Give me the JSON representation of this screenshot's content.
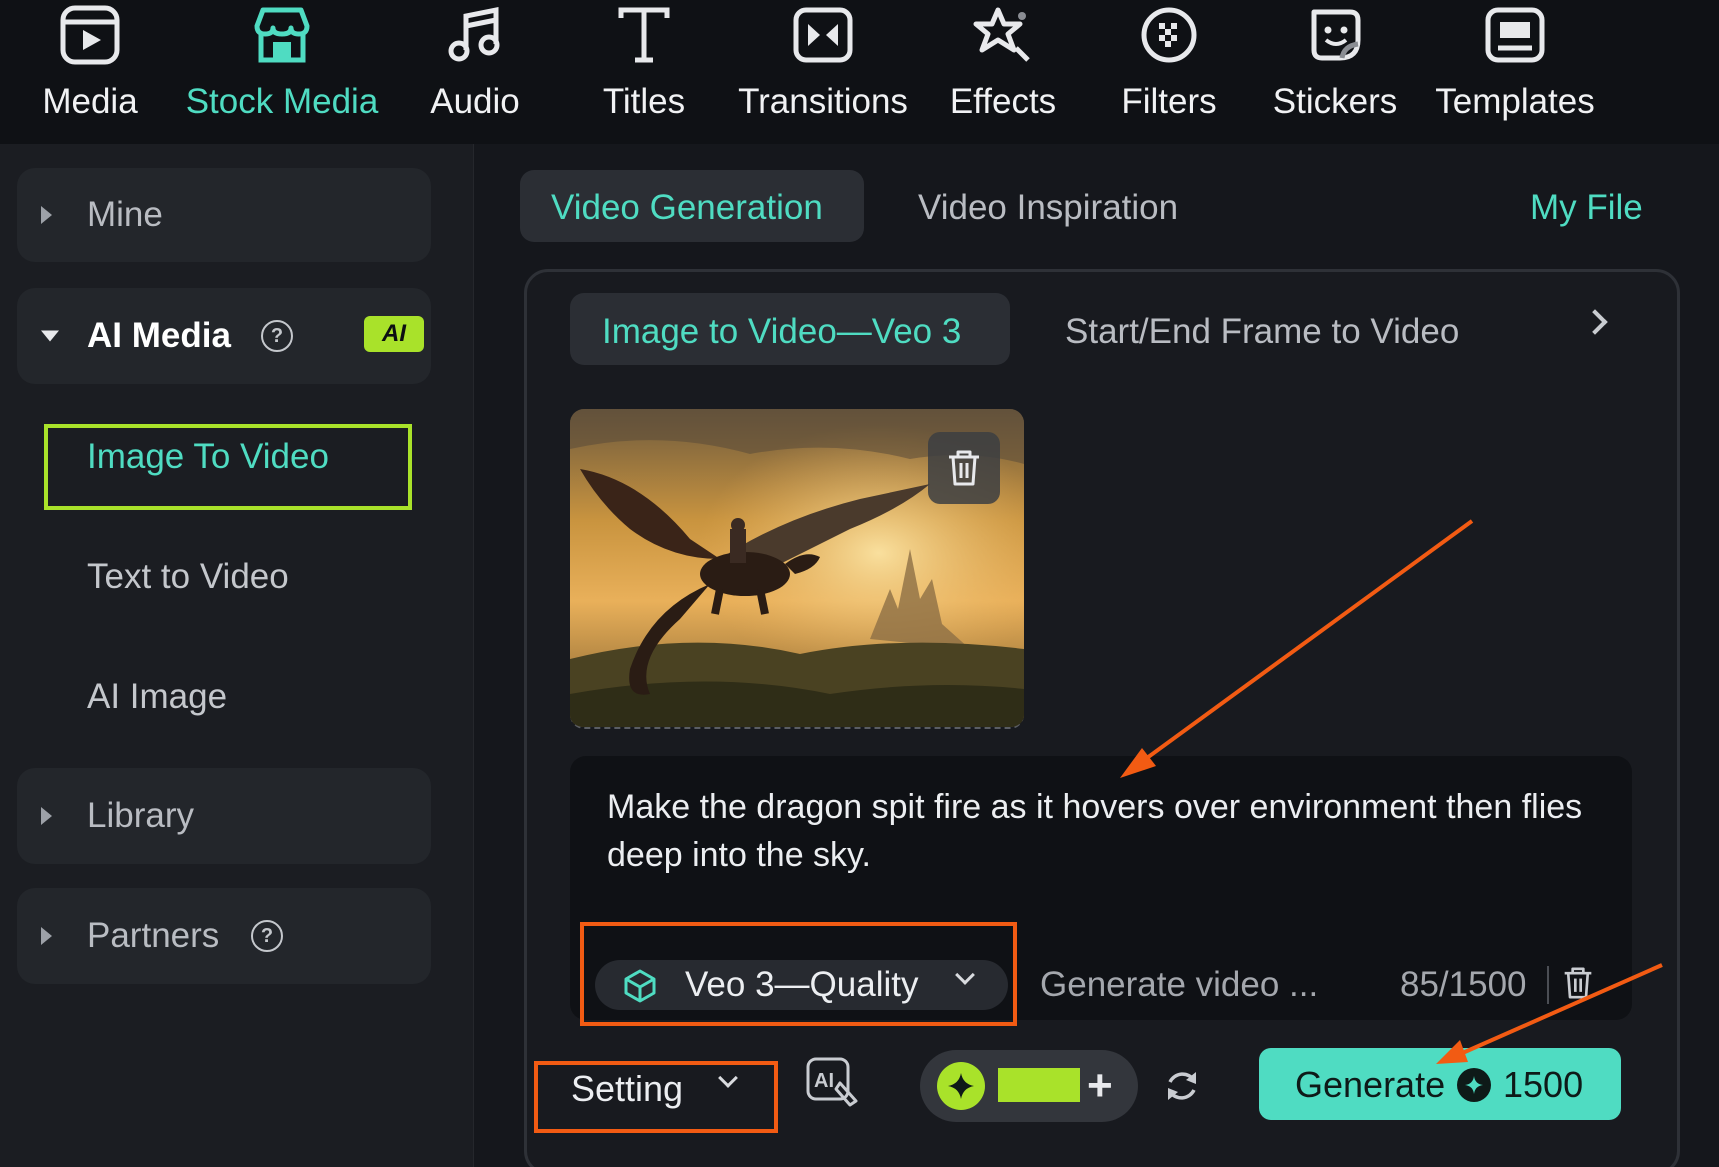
{
  "toolbar": {
    "items": [
      {
        "label": "Media",
        "icon": "media-icon"
      },
      {
        "label": "Stock Media",
        "icon": "stock-media-icon",
        "active": true
      },
      {
        "label": "Audio",
        "icon": "music-note-icon"
      },
      {
        "label": "Titles",
        "icon": "titles-icon"
      },
      {
        "label": "Transitions",
        "icon": "transitions-icon"
      },
      {
        "label": "Effects",
        "icon": "effects-icon"
      },
      {
        "label": "Filters",
        "icon": "filters-icon"
      },
      {
        "label": "Stickers",
        "icon": "stickers-icon"
      },
      {
        "label": "Templates",
        "icon": "templates-icon"
      }
    ]
  },
  "sidebar": {
    "mine": "Mine",
    "ai_media": "AI Media",
    "ai_badge": "AI",
    "sub_items": [
      "Image To Video",
      "Text to Video",
      "AI Image"
    ],
    "library": "Library",
    "partners": "Partners"
  },
  "main": {
    "tabs": [
      "Video Generation",
      "Video Inspiration"
    ],
    "my_file": "My File",
    "sub_tabs": [
      "Image to Video—Veo 3",
      "Start/End Frame to Video"
    ],
    "prompt": "Make the dragon spit fire as it hovers over environment then flies deep into the sky.",
    "model": "Veo 3—Quality",
    "hint": "Generate video ...",
    "char_count": "85/1500",
    "setting": "Setting",
    "generate": "Generate",
    "cost": "1500"
  },
  "colors": {
    "accent": "#4fdcc2",
    "ai_green": "#a9e22a",
    "annotation_orange": "#f25b13"
  }
}
